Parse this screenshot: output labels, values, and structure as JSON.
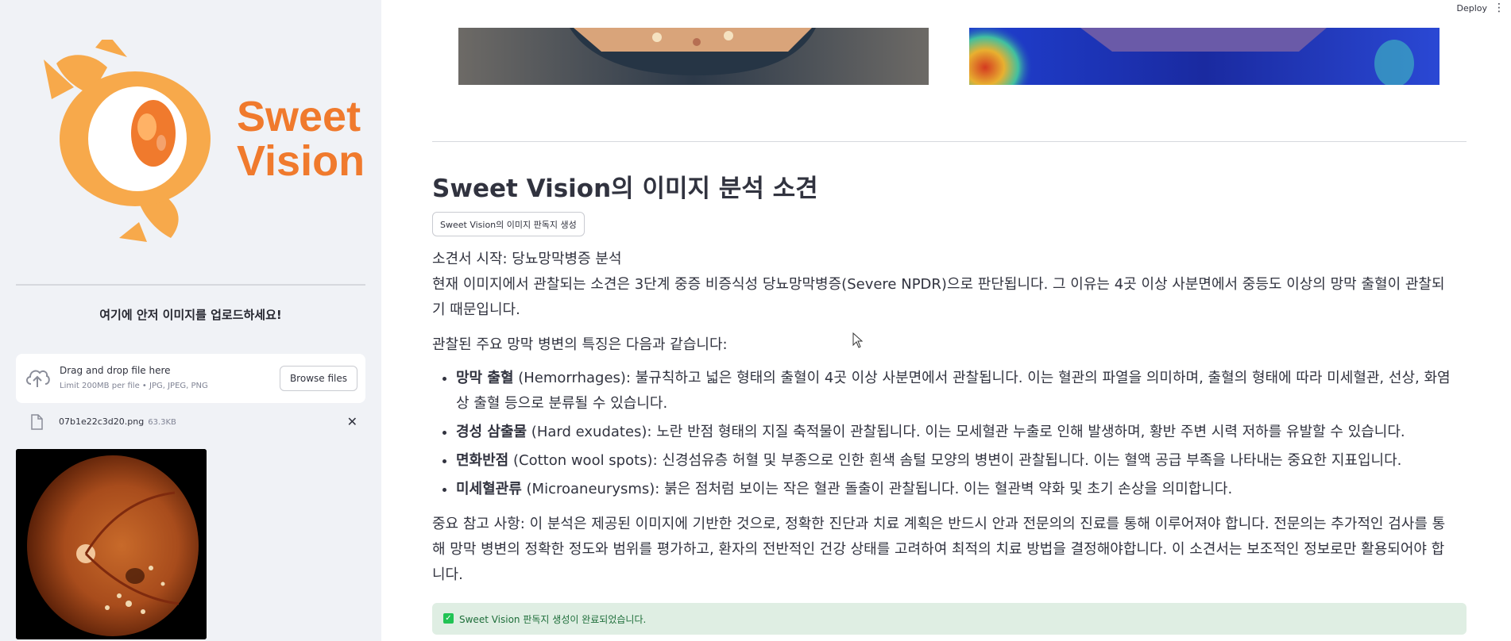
{
  "header": {
    "deploy_label": "Deploy",
    "menu_icon": "kebab-menu-icon"
  },
  "sidebar": {
    "logo": {
      "line1": "Sweet",
      "line2": "Vision",
      "brand_color": "#f07a2d",
      "icon": "candy-eye-logo"
    },
    "upload_title": "여기에 안저 이미지를 업로드하세요!",
    "dropzone": {
      "main_text": "Drag and drop file here",
      "limit_text": "Limit 200MB per file • JPG, JPEG, PNG",
      "browse_label": "Browse files",
      "icon": "cloud-upload-icon"
    },
    "uploaded_file": {
      "name": "07b1e22c3d20.png",
      "size": "63.3KB",
      "icon": "file-icon",
      "close_icon": "close-icon"
    }
  },
  "main": {
    "title": "Sweet Vision의 이미지 분석 소견",
    "generate_button": "Sweet Vision의 이미지 판독지 생성",
    "report": {
      "start_line": "소견서 시작: 당뇨망막병증 분석",
      "summary": "현재 이미지에서 관찰되는 소견은 3단계 중증 비증식성 당뇨망막병증(Severe NPDR)으로 판단됩니다. 그 이유는 4곳 이상 사분면에서 중등도 이상의 망막 출혈이 관찰되기 때문입니다.",
      "lesion_intro": "관찰된 주요 망막 병변의 특징은 다음과 같습니다:",
      "lesions": [
        {
          "term": "망막 출혈",
          "english": " (Hemorrhages):",
          "desc": " 불규칙하고 넓은 형태의 출혈이 4곳 이상 사분면에서 관찰됩니다. 이는 혈관의 파열을 의미하며, 출혈의 형태에 따라 미세혈관, 선상, 화염상 출혈 등으로 분류될 수 있습니다."
        },
        {
          "term": "경성 삼출물",
          "english": " (Hard exudates):",
          "desc": " 노란 반점 형태의 지질 축적물이 관찰됩니다. 이는 모세혈관 누출로 인해 발생하며, 황반 주변 시력 저하를 유발할 수 있습니다."
        },
        {
          "term": "면화반점",
          "english": " (Cotton wool spots):",
          "desc": " 신경섬유층 허혈 및 부종으로 인한 흰색 솜털 모양의 병변이 관찰됩니다. 이는 혈액 공급 부족을 나타내는 중요한 지표입니다."
        },
        {
          "term": "미세혈관류",
          "english": " (Microaneurysms):",
          "desc": " 붉은 점처럼 보이는 작은 혈관 돌출이 관찰됩니다. 이는 혈관벽 약화 및 초기 손상을 의미합니다."
        }
      ],
      "note": "중요 참고 사항: 이 분석은 제공된 이미지에 기반한 것으로, 정확한 진단과 치료 계획은 반드시 안과 전문의의 진료를 통해 이루어져야 합니다. 전문의는 추가적인 검사를 통해 망막 병변의 정확한 정도와 범위를 평가하고, 환자의 전반적인 건강 상태를 고려하여 최적의 치료 방법을 결정해야합니다. 이 소견서는 보조적인 정보로만 활용되어야 합니다."
    },
    "success_message": "Sweet Vision 판독지 생성이 완료되었습니다.",
    "success_icon": "check-icon"
  }
}
